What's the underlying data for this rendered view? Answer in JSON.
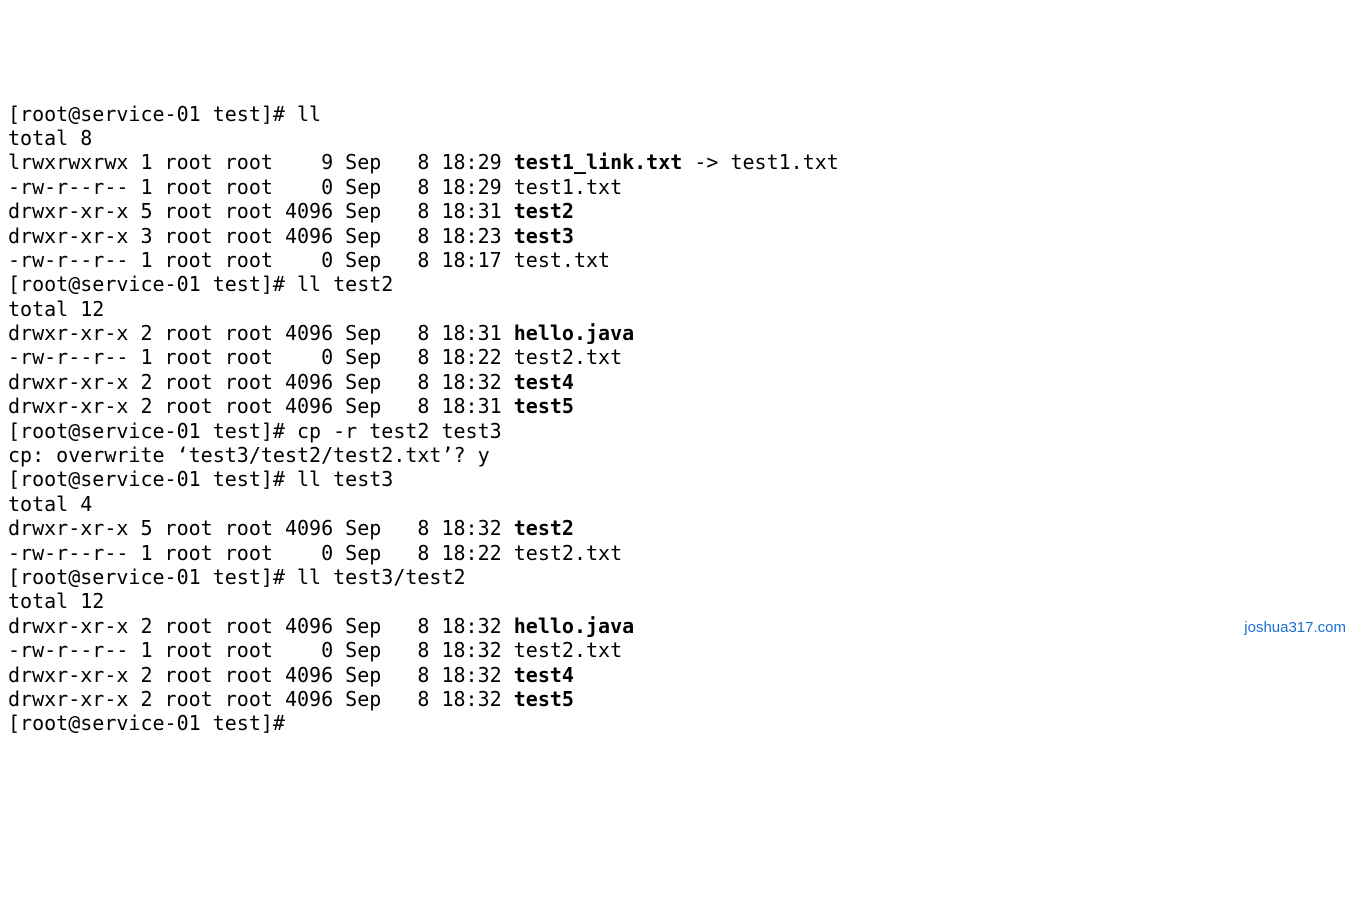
{
  "prompt_prefix": "[root@service-01 test]# ",
  "commands": {
    "cmd1": "ll",
    "cmd2": "ll test2",
    "cmd3": "cp -r test2 test3",
    "cmd4": "ll test3",
    "cmd5": "ll test3/test2",
    "cmd6": ""
  },
  "ls1": {
    "total": "total 8",
    "rows": [
      {
        "perm": "lrwxrwxrwx",
        "links": "1",
        "user": "root",
        "group": "root",
        "size": "   9",
        "month": "Sep",
        "day": "  8",
        "time": "18:29",
        "name": "test1_link.txt",
        "bold": true,
        "suffix": " -> test1.txt"
      },
      {
        "perm": "-rw-r--r--",
        "links": "1",
        "user": "root",
        "group": "root",
        "size": "   0",
        "month": "Sep",
        "day": "  8",
        "time": "18:29",
        "name": "test1.txt",
        "bold": false,
        "suffix": ""
      },
      {
        "perm": "drwxr-xr-x",
        "links": "5",
        "user": "root",
        "group": "root",
        "size": "4096",
        "month": "Sep",
        "day": "  8",
        "time": "18:31",
        "name": "test2",
        "bold": true,
        "suffix": ""
      },
      {
        "perm": "drwxr-xr-x",
        "links": "3",
        "user": "root",
        "group": "root",
        "size": "4096",
        "month": "Sep",
        "day": "  8",
        "time": "18:23",
        "name": "test3",
        "bold": true,
        "suffix": ""
      },
      {
        "perm": "-rw-r--r--",
        "links": "1",
        "user": "root",
        "group": "root",
        "size": "   0",
        "month": "Sep",
        "day": "  8",
        "time": "18:17",
        "name": "test.txt",
        "bold": false,
        "suffix": ""
      }
    ]
  },
  "ls2": {
    "total": "total 12",
    "rows": [
      {
        "perm": "drwxr-xr-x",
        "links": "2",
        "user": "root",
        "group": "root",
        "size": "4096",
        "month": "Sep",
        "day": "  8",
        "time": "18:31",
        "name": "hello.java",
        "bold": true,
        "suffix": ""
      },
      {
        "perm": "-rw-r--r--",
        "links": "1",
        "user": "root",
        "group": "root",
        "size": "   0",
        "month": "Sep",
        "day": "  8",
        "time": "18:22",
        "name": "test2.txt",
        "bold": false,
        "suffix": ""
      },
      {
        "perm": "drwxr-xr-x",
        "links": "2",
        "user": "root",
        "group": "root",
        "size": "4096",
        "month": "Sep",
        "day": "  8",
        "time": "18:32",
        "name": "test4",
        "bold": true,
        "suffix": ""
      },
      {
        "perm": "drwxr-xr-x",
        "links": "2",
        "user": "root",
        "group": "root",
        "size": "4096",
        "month": "Sep",
        "day": "  8",
        "time": "18:31",
        "name": "test5",
        "bold": true,
        "suffix": ""
      }
    ]
  },
  "cp_confirm": "cp: overwrite ‘test3/test2/test2.txt’? y",
  "ls3": {
    "total": "total 4",
    "rows": [
      {
        "perm": "drwxr-xr-x",
        "links": "5",
        "user": "root",
        "group": "root",
        "size": "4096",
        "month": "Sep",
        "day": "  8",
        "time": "18:32",
        "name": "test2",
        "bold": true,
        "suffix": ""
      },
      {
        "perm": "-rw-r--r--",
        "links": "1",
        "user": "root",
        "group": "root",
        "size": "   0",
        "month": "Sep",
        "day": "  8",
        "time": "18:22",
        "name": "test2.txt",
        "bold": false,
        "suffix": ""
      }
    ]
  },
  "ls4": {
    "total": "total 12",
    "rows": [
      {
        "perm": "drwxr-xr-x",
        "links": "2",
        "user": "root",
        "group": "root",
        "size": "4096",
        "month": "Sep",
        "day": "  8",
        "time": "18:32",
        "name": "hello.java",
        "bold": true,
        "suffix": ""
      },
      {
        "perm": "-rw-r--r--",
        "links": "1",
        "user": "root",
        "group": "root",
        "size": "   0",
        "month": "Sep",
        "day": "  8",
        "time": "18:32",
        "name": "test2.txt",
        "bold": false,
        "suffix": ""
      },
      {
        "perm": "drwxr-xr-x",
        "links": "2",
        "user": "root",
        "group": "root",
        "size": "4096",
        "month": "Sep",
        "day": "  8",
        "time": "18:32",
        "name": "test4",
        "bold": true,
        "suffix": ""
      },
      {
        "perm": "drwxr-xr-x",
        "links": "2",
        "user": "root",
        "group": "root",
        "size": "4096",
        "month": "Sep",
        "day": "  8",
        "time": "18:32",
        "name": "test5",
        "bold": true,
        "suffix": ""
      }
    ]
  },
  "watermark": "joshua317.com"
}
